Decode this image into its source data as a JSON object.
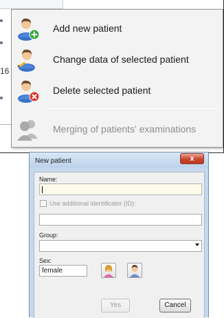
{
  "context_menu": {
    "items": [
      {
        "label": "Add new patient",
        "icon": "add-patient-icon",
        "enabled": true
      },
      {
        "label": "Change data of selected patient",
        "icon": "edit-patient-icon",
        "enabled": true
      },
      {
        "label": "Delete selected patient",
        "icon": "delete-patient-icon",
        "enabled": true
      },
      {
        "label": "Merging of patients' examinations",
        "icon": "merge-patients-icon",
        "enabled": false
      }
    ]
  },
  "background": {
    "digits": "16"
  },
  "dialog": {
    "title": "New patient",
    "close_label": "x",
    "name_label": "Name:",
    "name_value": "",
    "id_checkbox_label": "Use additional identificator (ID):",
    "id_checked": false,
    "group_label": "Group:",
    "group_value": "",
    "sex_label": "Sex:",
    "sex_value": "female",
    "yes_label": "Yes",
    "cancel_label": "Cancel"
  },
  "colors": {
    "add_accent": "#3aa844",
    "delete_accent": "#d9362b",
    "close_button": "#c9442c",
    "name_field_bg": "#fffbea"
  }
}
